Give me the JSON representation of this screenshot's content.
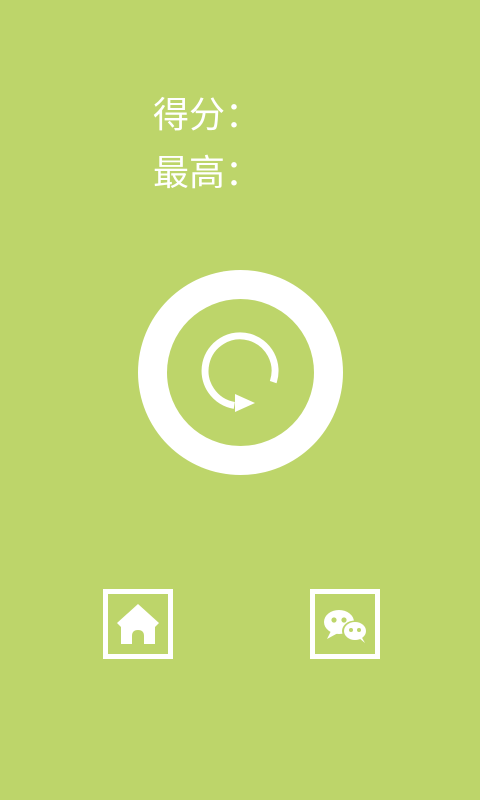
{
  "labels": {
    "score": "得分：",
    "best": "最高："
  },
  "colors": {
    "background": "#bdd56a",
    "foreground": "#ffffff"
  },
  "icons": {
    "restart": "restart-icon",
    "home": "home-icon",
    "share": "wechat-icon"
  }
}
